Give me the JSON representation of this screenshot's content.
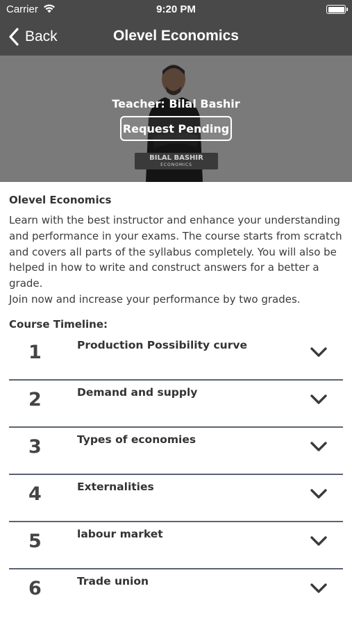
{
  "status_bar": {
    "carrier": "Carrier",
    "time": "9:20 PM",
    "icons": [
      "wifi-icon",
      "battery-icon"
    ]
  },
  "nav": {
    "back_label": "Back",
    "title": "Olevel Economics"
  },
  "hero": {
    "teacher_text": "Teacher: Bilal Bashir",
    "button_label": "Request Pending",
    "plate_name": "BILAL BASHIR",
    "plate_sub": "ECONOMICS"
  },
  "course": {
    "name": "Olevel Economics",
    "description": "Learn with the best instructor and enhance your understanding and performance in your exams. The course starts from scratch and covers all parts of the syllabus completely. You will also be helped in how to write and construct answers for a better a grade.\nJoin now and increase your performance by two grades.",
    "timeline_heading": "Course Timeline:"
  },
  "timeline": [
    {
      "number": "1",
      "title": "Production Possibility curve"
    },
    {
      "number": "2",
      "title": "Demand and supply"
    },
    {
      "number": "3",
      "title": "Types of economies"
    },
    {
      "number": "4",
      "title": "Externalities"
    },
    {
      "number": "5",
      "title": "labour market"
    },
    {
      "number": "6",
      "title": "Trade union"
    }
  ],
  "colors": {
    "header_bg": "#494949",
    "hero_bg": "#7a7a7a",
    "divider": "#5a6272",
    "text": "#333333"
  }
}
